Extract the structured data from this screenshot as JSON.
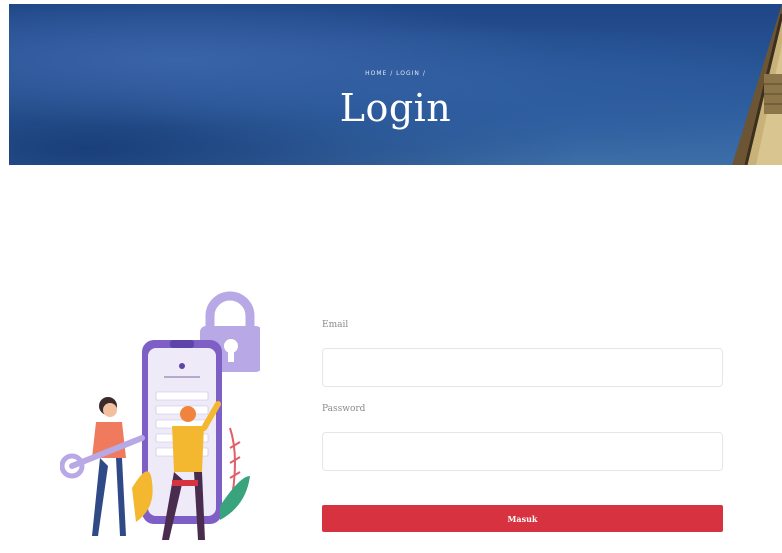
{
  "hero": {
    "breadcrumb": "HOME / LOGIN /",
    "title": "Login"
  },
  "form": {
    "email_label": "Email",
    "email_value": "",
    "password_label": "Password",
    "password_value": "",
    "submit_label": "Masuk"
  },
  "colors": {
    "accent": "#d7323f",
    "hero_blue": "#2b5a9b",
    "phone_purple": "#7d5fc6",
    "lock_lavender": "#b9a8e6"
  }
}
